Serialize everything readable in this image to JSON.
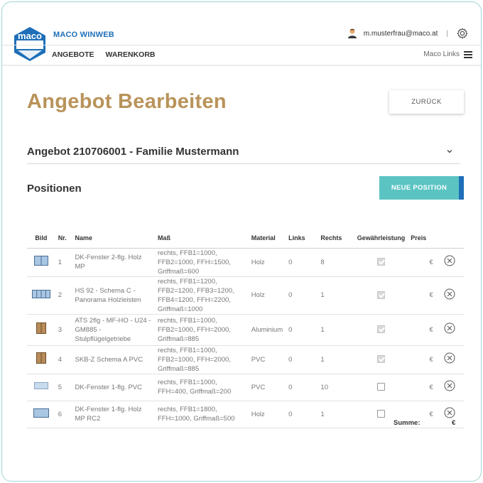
{
  "header": {
    "brand": "MACO WINWEB",
    "nav": [
      "ANGEBOTE",
      "WARENKORB"
    ],
    "user_email": "m.musterfrau@maco.at",
    "separator": "|",
    "links_label": "Maco Links"
  },
  "page": {
    "title": "Angebot Bearbeiten",
    "back_button": "ZURÜCK",
    "offer_title": "Angebot 210706001 - Familie Mustermann",
    "positions_title": "Positionen",
    "new_position_button": "NEUE POSITION"
  },
  "table": {
    "headers": [
      "Bild",
      "Nr.",
      "Name",
      "Maß",
      "Material",
      "Links",
      "Rechts",
      "Gewährleistung",
      "Preis"
    ],
    "rows": [
      {
        "nr": "1",
        "name": "DK-Fenster 2-flg. Holz MP",
        "mass": "rechts, FFB1=1000, FFB2=1000, FFH=1500, Griffmaß=600",
        "material": "Holz",
        "links": "0",
        "rechts": "8",
        "warranty": true,
        "price": "€",
        "thumb": "window-double"
      },
      {
        "nr": "2",
        "name": "HS 92 - Schema C - Panorama Holzleisten",
        "mass": "rechts, FFB1=1200, FFB2=1200, FFB3=1200, FFB4=1200, FFH=2200, Griffmaß=1000",
        "material": "Holz",
        "links": "0",
        "rechts": "1",
        "warranty": true,
        "price": "€",
        "thumb": "window-panorama"
      },
      {
        "nr": "3",
        "name": "ATS 2flg - MF-HO - U24 - GM885 - Stulpflügelgetriebe",
        "mass": "rechts, FFB1=1000, FFB2=1000, FFH=2000, Griffmaß=885",
        "material": "Aluminium",
        "links": "0",
        "rechts": "1",
        "warranty": true,
        "price": "€",
        "thumb": "door-double"
      },
      {
        "nr": "4",
        "name": "SKB-Z Schema A PVC",
        "mass": "rechts, FFB1=1000, FFB2=1000, FFH=2000, Griffmaß=885",
        "material": "PVC",
        "links": "0",
        "rechts": "1",
        "warranty": true,
        "price": "€",
        "thumb": "door-double"
      },
      {
        "nr": "5",
        "name": "DK-Fenster 1-flg. PVC",
        "mass": "rechts, FFB1=1000, FFH=400, Griffmaß=200",
        "material": "PVC",
        "links": "0",
        "rechts": "10",
        "warranty": false,
        "price": "€",
        "thumb": "window-low"
      },
      {
        "nr": "6",
        "name": "DK-Fenster 1-flg. Holz MP RC2",
        "mass": "rechts, FFB1=1800, FFH=1000, Griffmaß=500",
        "material": "Holz",
        "links": "0",
        "rechts": "1",
        "warranty": false,
        "price": "€",
        "thumb": "window-wide"
      }
    ],
    "sum_label": "Summe:",
    "sum_value": "€"
  },
  "colors": {
    "accent_gold": "#b9935a",
    "brand_blue": "#1e6fb8",
    "teal": "#5bc4c3"
  }
}
